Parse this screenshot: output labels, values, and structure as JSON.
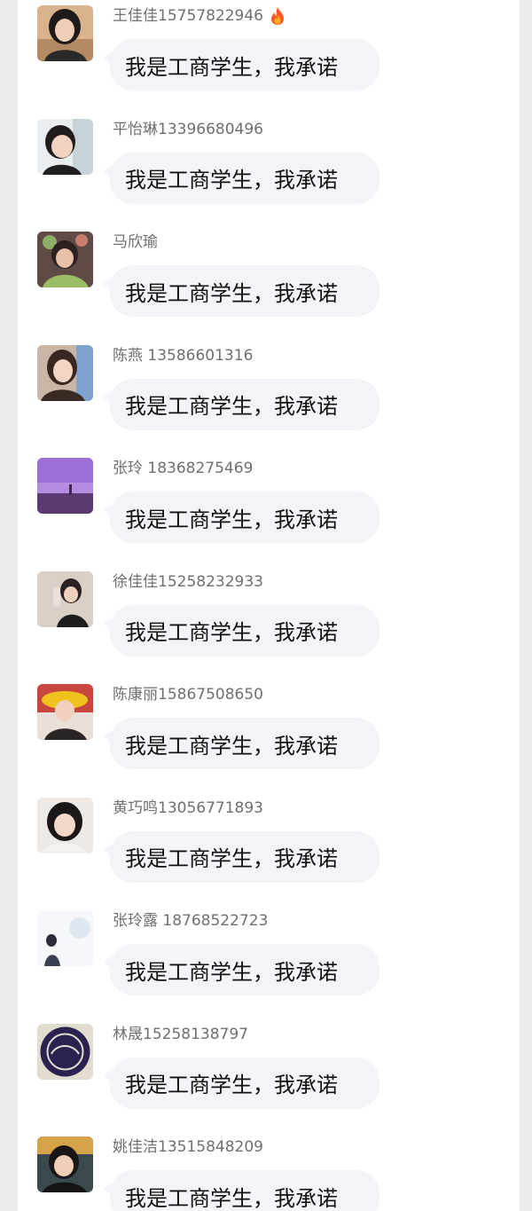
{
  "colors": {
    "page_background": "#ececec",
    "panel_background": "#ffffff",
    "bubble_background": "#f4f4f8",
    "name_text": "#6f6f6f",
    "message_text": "#111111",
    "fire_accent": "#ff5a1f"
  },
  "messages": [
    {
      "sender": "王佳佳15757822946",
      "text": "我是工商学生，我承诺",
      "badge_icon": "fire-icon",
      "avatar_icon": "avatar-photo-icon"
    },
    {
      "sender": "平怡琳13396680496",
      "text": "我是工商学生，我承诺",
      "avatar_icon": "avatar-photo-icon"
    },
    {
      "sender": "马欣瑜",
      "text": "我是工商学生，我承诺",
      "avatar_icon": "avatar-photo-icon"
    },
    {
      "sender": "陈燕 13586601316",
      "text": "我是工商学生，我承诺",
      "avatar_icon": "avatar-photo-icon"
    },
    {
      "sender": "张玲 18368275469",
      "text": "我是工商学生，我承诺",
      "avatar_icon": "avatar-photo-icon"
    },
    {
      "sender": "徐佳佳15258232933",
      "text": "我是工商学生，我承诺",
      "avatar_icon": "avatar-photo-icon"
    },
    {
      "sender": "陈康丽15867508650",
      "text": "我是工商学生，我承诺",
      "avatar_icon": "avatar-photo-icon"
    },
    {
      "sender": "黄巧鸣13056771893",
      "text": "我是工商学生，我承诺",
      "avatar_icon": "avatar-photo-icon"
    },
    {
      "sender": "张玲露 18768522723",
      "text": "我是工商学生，我承诺",
      "avatar_icon": "avatar-photo-icon"
    },
    {
      "sender": "林晟15258138797",
      "text": "我是工商学生，我承诺",
      "avatar_icon": "avatar-photo-icon"
    },
    {
      "sender": "姚佳洁13515848209",
      "text": "我是工商学生，我承诺",
      "avatar_icon": "avatar-photo-icon"
    }
  ]
}
